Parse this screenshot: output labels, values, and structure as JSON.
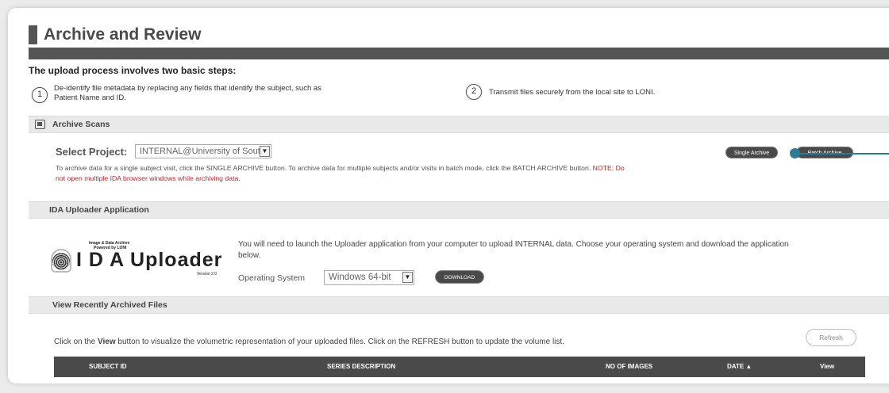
{
  "page": {
    "title": "Archive and Review"
  },
  "steps": {
    "heading": "The upload process involves two basic steps:",
    "items": [
      {
        "num": "1",
        "text_line1": "De-identify file metadata by replacing any fields that identify the subject, such as",
        "text_line2": "Patient Name and ID."
      },
      {
        "num": "2",
        "text_line1": "Transmit files securely from the local site to LONI."
      }
    ]
  },
  "archive_scans": {
    "heading": "Archive Scans",
    "select_label": "Select Project:",
    "project_value": "INTERNAL@University of Soutl",
    "instructions_main": "To archive data for a single subject visit, click the SINGLE ARCHIVE button. To archive data for multiple subjects and/or visits in batch mode, click the BATCH ARCHIVE button.",
    "instructions_note_line1": "NOTE: Do",
    "instructions_note_line2": "not open multiple IDA browser windows while archiving data.",
    "single_archive_label": "Single Archive",
    "batch_archive_label": "Batch Archive"
  },
  "uploader": {
    "heading": "IDA Uploader Application",
    "logo_tagline_1": "Image & Data Archive",
    "logo_tagline_2": "Powered by LONI",
    "logo_text": "I D A Uploader",
    "logo_version": "Version 2.0",
    "description_line1": "You will need to launch the Uploader application from your computer to upload INTERNAL data. Choose your operating system and download the application",
    "description_line2": "below.",
    "os_label": "Operating System",
    "os_value": "Windows 64-bit",
    "download_label": "DOWNLOAD"
  },
  "recent": {
    "heading": "View Recently Archived Files",
    "instruction_pre": "Click on the ",
    "instruction_bold": "View",
    "instruction_post": " button to visualize the volumetric representation of your uploaded files. Click on the REFRESH button to update the volume list.",
    "refresh_label": "Refresh",
    "columns": [
      "SUBJECT ID",
      "SERIES DESCRIPTION",
      "NO OF IMAGES",
      "DATE ▲",
      "View"
    ]
  },
  "colors": {
    "dark_bar": "#555555",
    "callout": "#2a7c97",
    "note_red": "#c0262c"
  }
}
